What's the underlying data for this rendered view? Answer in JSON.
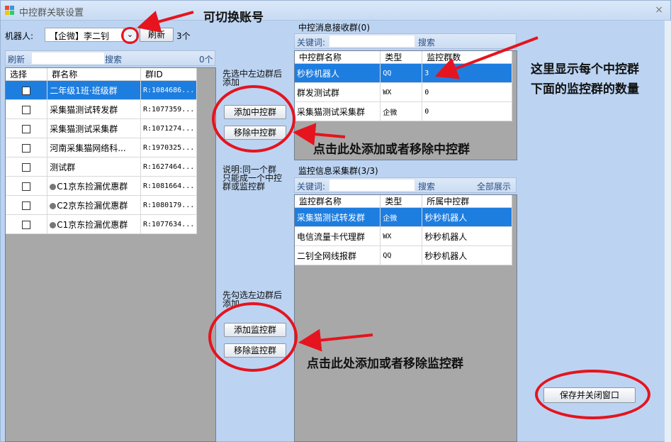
{
  "window": {
    "title": "中控群关联设置",
    "close": "×"
  },
  "robot": {
    "label": "机器人:",
    "selected": "【企微】李二钊",
    "refresh": "刷新",
    "count": "3个"
  },
  "left_search": {
    "refresh": "刷新",
    "search": "搜索",
    "count": "0个"
  },
  "left_table": {
    "headers": [
      "选择",
      "群名称",
      "群ID"
    ],
    "rows": [
      {
        "name": "二年级1班·班级群",
        "id": "R:1084686...",
        "dot": false,
        "selected": true
      },
      {
        "name": "采集猫测试转发群",
        "id": "R:1077359...",
        "dot": false,
        "selected": false
      },
      {
        "name": "采集猫测试采集群",
        "id": "R:1071274...",
        "dot": false,
        "selected": false
      },
      {
        "name": "河南采集猫网络科...",
        "id": "R:1970325...",
        "dot": false,
        "selected": false
      },
      {
        "name": "测试群",
        "id": "R:1627464...",
        "dot": false,
        "selected": false
      },
      {
        "name": "C1京东捡漏优惠群",
        "id": "R:1081664...",
        "dot": true,
        "selected": false
      },
      {
        "name": "C2京东捡漏优惠群",
        "id": "R:1080179...",
        "dot": true,
        "selected": false
      },
      {
        "name": "C1京东捡漏优惠群",
        "id": "R:1077634...",
        "dot": true,
        "selected": false
      }
    ]
  },
  "middle": {
    "hint1": "先选中左边群后添加",
    "add_center": "添加中控群",
    "remove_center": "移除中控群",
    "note": "说明:同一个群只能成一个中控群或监控群",
    "hint2": "先勾选左边群后添加",
    "add_monitor": "添加监控群",
    "remove_monitor": "移除监控群"
  },
  "center_panel": {
    "title": "中控消息接收群(0)",
    "keyword": "关键词:",
    "search": "搜索",
    "headers": [
      "中控群名称",
      "类型",
      "监控群数"
    ],
    "rows": [
      {
        "name": "秒秒机器人",
        "type": "QQ",
        "count": "3",
        "selected": true
      },
      {
        "name": "群发测试群",
        "type": "WX",
        "count": "0",
        "selected": false
      },
      {
        "name": "采集猫测试采集群",
        "type": "企微",
        "count": "0",
        "selected": false
      }
    ]
  },
  "monitor_panel": {
    "title": "监控信息采集群(3/3)",
    "keyword": "关键词:",
    "search": "搜索",
    "show_all": "全部展示",
    "headers": [
      "监控群名称",
      "类型",
      "所属中控群"
    ],
    "rows": [
      {
        "name": "采集猫测试转发群",
        "type": "企微",
        "owner": "秒秒机器人",
        "selected": true
      },
      {
        "name": "电信流量卡代理群",
        "type": "WX",
        "owner": "秒秒机器人",
        "selected": false
      },
      {
        "name": "二钊全网线报群",
        "type": "QQ",
        "owner": "秒秒机器人",
        "selected": false
      }
    ]
  },
  "save_button": "保存并关闭窗口",
  "annotations": {
    "switch_account": "可切换账号",
    "count_note_line1": "这里显示每个中控群",
    "count_note_line2": "下面的监控群的数量",
    "center_note": "点击此处添加或者移除中控群",
    "monitor_note": "点击此处添加或者移除监控群"
  },
  "colors": {
    "accent": "#1e7ee0",
    "annotation_red": "#e5141e",
    "window_bg": "#bcd4f2"
  }
}
